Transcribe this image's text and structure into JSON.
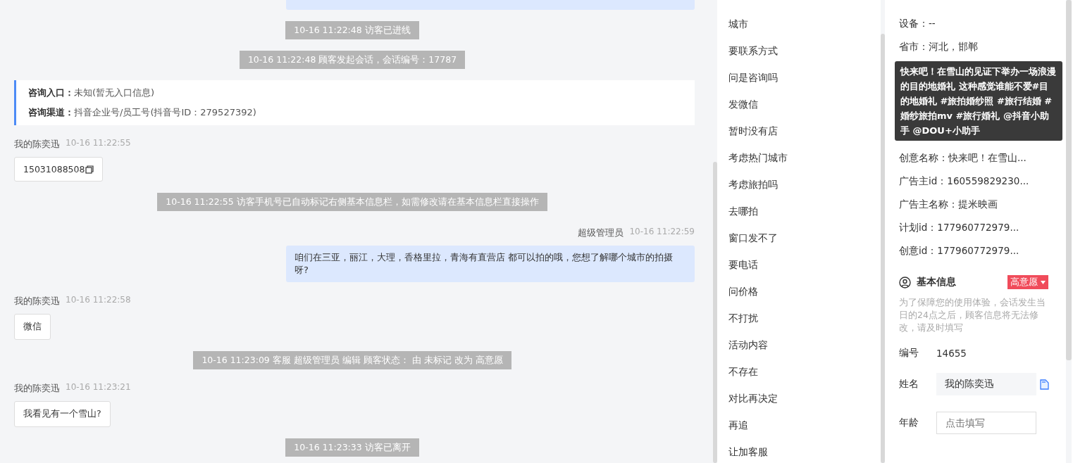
{
  "chat": {
    "messages": [
      {
        "kind": "system",
        "text": "10-16 11:22:48 访客已进线"
      },
      {
        "kind": "system",
        "text": "10-16 11:22:48 顾客发起会话，会话编号：17787"
      },
      {
        "kind": "info",
        "lines": [
          {
            "label": "咨询入口：",
            "value": "未知(暂无入口信息)"
          },
          {
            "label": "咨询渠道：",
            "value": "抖音企业号/员工号(抖音号ID：279527392)"
          }
        ]
      },
      {
        "kind": "visitor",
        "sender": "我的陈奕迅",
        "time": "10-16 11:22:55",
        "text": "15031088508",
        "copyable": true
      },
      {
        "kind": "system",
        "text": "10-16 11:22:55 访客手机号已自动标记右侧基本信息栏，如需修改请在基本信息栏直接操作"
      },
      {
        "kind": "agent",
        "sender": "超级管理员",
        "time": "10-16 11:22:59",
        "text": "咱们在三亚，丽江，大理，香格里拉，青海有直营店 都可以拍的哦，您想了解哪个城市的拍摄呀?"
      },
      {
        "kind": "visitor",
        "sender": "我的陈奕迅",
        "time": "10-16 11:22:58",
        "text": "微信",
        "copyable": false
      },
      {
        "kind": "system",
        "text": "10-16 11:23:09 客服 超级管理员 编辑 顾客状态： 由 未标记 改为 高意愿"
      },
      {
        "kind": "visitor",
        "sender": "我的陈奕迅",
        "time": "10-16 11:23:21",
        "text": "我看见有一个雪山?",
        "copyable": false
      },
      {
        "kind": "system",
        "text": "10-16 11:23:33 访客已离开"
      }
    ]
  },
  "tags": [
    "城市",
    "要联系方式",
    "问是咨询吗",
    "发微信",
    "暂时没有店",
    "考虑热门城市",
    "考虑旅拍吗",
    "去哪拍",
    "窗口发不了",
    "要电话",
    "问价格",
    "不打扰",
    "活动内容",
    "不存在",
    "对比再决定",
    "再追",
    "让加客服"
  ],
  "visit_info": {
    "rows_top": [
      "设备：--",
      "省市：河北，邯郸"
    ],
    "tooltip": "快来吧！在雪山的见证下举办一场浪漫的目的地婚礼 这种感觉谁能不爱#目的地婚礼 #旅拍婚纱照 #旅行结婚 #婚纱旅拍mv #旅行婚礼 @抖音小助手 @DOU+小助手",
    "rows_bottom": [
      "创意名称：快来吧！在雪山...",
      "广告主id：160559829230...",
      "广告主名称：提米映画",
      "计划id：177960772979...",
      "创意id：177960772979..."
    ]
  },
  "basic_info": {
    "title": "基本信息",
    "status": "高意愿",
    "notice": "为了保障您的使用体验，会话发生当日的24点之后，顾客信息将无法修改，请及时填写",
    "fields": [
      {
        "kind": "text",
        "label": "编号",
        "value": "14655"
      },
      {
        "kind": "filled",
        "label": "姓名",
        "value": "我的陈奕迅"
      },
      {
        "kind": "input",
        "label": "年龄",
        "placeholder": "点击填写"
      }
    ]
  }
}
